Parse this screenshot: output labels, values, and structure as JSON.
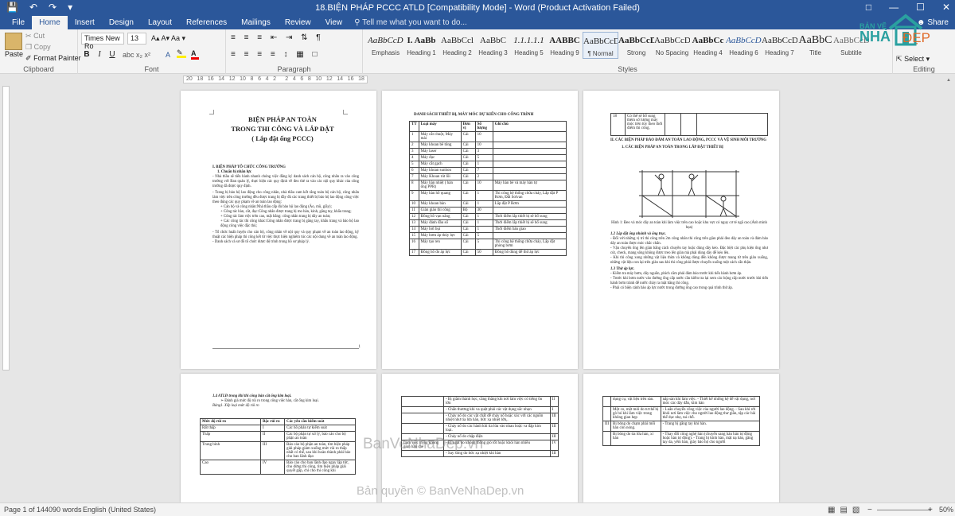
{
  "window": {
    "title": "18.BIỆN PHÁP PCCC  ATLD [Compatibility Mode] - Word (Product Activation Failed)",
    "share": "Share"
  },
  "ribbon": {
    "tabs": [
      "File",
      "Home",
      "Insert",
      "Design",
      "Layout",
      "References",
      "Mailings",
      "Review",
      "View"
    ],
    "active": "Home",
    "tell_me": "Tell me what you want to do...",
    "clipboard": {
      "paste": "Paste",
      "cut": "Cut",
      "copy": "Copy",
      "format_painter": "Format Painter",
      "label": "Clipboard"
    },
    "font": {
      "name": "Times New Ro",
      "size": "13",
      "label": "Font",
      "bold": "B",
      "italic": "I",
      "underline": "U"
    },
    "paragraph": {
      "label": "Paragraph"
    },
    "styles": {
      "label": "Styles",
      "items": [
        {
          "preview": "AaBbCcDc",
          "name": "Emphasis"
        },
        {
          "preview": "I. AaBb",
          "name": "Heading 1"
        },
        {
          "preview": "AaBbCcl",
          "name": "Heading 2"
        },
        {
          "preview": "AaBbC",
          "name": "Heading 3"
        },
        {
          "preview": "1.1.1.1.1",
          "name": "Heading 5"
        },
        {
          "preview": "AABBC",
          "name": "Heading 9"
        },
        {
          "preview": "AaBbCcDc",
          "name": "¶ Normal"
        },
        {
          "preview": "AaBbCcDc",
          "name": "Strong"
        },
        {
          "preview": "AaBbCcDdI",
          "name": "No Spacing"
        },
        {
          "preview": "AaBbCc",
          "name": "Heading 4"
        },
        {
          "preview": "AaBbCcDd",
          "name": "Heading 6"
        },
        {
          "preview": "AaBbCcD",
          "name": "Heading 7"
        },
        {
          "preview": "AaBbC",
          "name": "Title"
        },
        {
          "preview": "AaBbCcDd",
          "name": "Subtitle"
        }
      ],
      "selected": "¶ Normal"
    },
    "editing": {
      "select": "Select",
      "label": "Editing"
    }
  },
  "logo": {
    "line1": "BẢN VẼ",
    "line2": "NHÀ",
    "line3": "ĐẸP"
  },
  "ruler": {
    "ticks": [
      "20",
      "18",
      "16",
      "14",
      "12",
      "10",
      "8",
      "6",
      "4",
      "2",
      "",
      "2",
      "4",
      "6",
      "8",
      "10",
      "12",
      "14",
      "16",
      "18"
    ]
  },
  "page1": {
    "title": [
      "BIỆN PHÁP AN TOÀN",
      "TRONG THI CÔNG VÀ LẮP ĐẶT",
      "( Lắp đặt ống PCCC)"
    ],
    "section": "I. BIỆN PHÁP TỔ CHỨC CÔNG TRƯỜNG",
    "sub": "1.   Chuẩn bị nhân lực",
    "paras": [
      "-  Nhà thầu sẽ tiến hành nhanh chóng việc đăng ký danh sách cán bộ, công nhân ra vào công trường với Ban quản lý, thực hiện các quy định về đeo thẻ ra vào các nội quy khác của công trường đã được quy định.",
      "-  Trang bị bảo hộ lao động cho công nhân, nhà thầu cam kết rằng toàn bộ cán bộ, công nhân làm việc trên công trường đều được trang bị đầy đủ các trang thiết bị bảo hộ lao động công việc theo đúng các quy phạm về an toàn lao động:",
      "+ Cán bộ và công nhân:Nhà thầu cấp đủ bảo hộ lao động (Áo, mũ, giầy);",
      "+ Công tác hàn, cắt, đục:Công nhân được trang bị mo hàn, kính, găng tay, khẩu trang;",
      "+ Công tác làm việc trên cao, mặt bằng: công nhân trang bị dây an toàn;",
      "+ Các công tác thi công khác:Công nhân được trang bị găng tay, khẩu trang và bảo hộ lao động công việc đặc thù;",
      "-  Tổ chức huấn luyện cho cán bộ, công nhân về nội quy và quy phạm về an toàn lao động, kỹ thuật các biện pháp thi công kết từ việc thực hiện nghiêm túc các nội dung về an toàn lao động.",
      "-  Danh sách và sơ đồ tổ chức được đệ trình trong hồ sơ pháp lý."
    ],
    "page_num": "1"
  },
  "page2": {
    "title": "DANH SÁCH THIẾT BỊ, MÁY MÓC DỰ KIẾN CHO CÔNG TRÌNH",
    "headers": [
      "TT",
      "Loại máy",
      "Đơn vị",
      "Số lượng",
      "Ghi chú"
    ],
    "rows": [
      [
        "1",
        "Máy cắt chuột, Máy mài",
        "Cái",
        "10",
        ""
      ],
      [
        "2",
        "Máy khoan bê tông",
        "Cái",
        "10",
        ""
      ],
      [
        "3",
        "Máy laser",
        "Cái",
        "3",
        ""
      ],
      [
        "4",
        "Máy đục",
        "Cái",
        "5",
        ""
      ],
      [
        "5",
        "Máy cắt gạch",
        "Cái",
        "1",
        ""
      ],
      [
        "6",
        "Máy khoan sunhon",
        "Cái",
        "7",
        ""
      ],
      [
        "7",
        "Máy Khoan rút lõi",
        "Cái",
        "2",
        ""
      ],
      [
        "8",
        "Máy hàn nhiệt ( hàn ống PPR)",
        "Cái",
        "10",
        "Máy hàn bè và máy hàn tự"
      ],
      [
        "9",
        "Máy hàn hồ quang",
        "Cái",
        "1",
        "Thi công hệ thống chữa cháy, Lắp đặt P Rơm, Đất Solvan"
      ],
      [
        "10",
        "Máy khoan bàn",
        "Cái",
        "1",
        "Lắp đặt P Rơm"
      ],
      [
        "11",
        "Giàn giáo thi công",
        "Bộ",
        "30",
        ""
      ],
      [
        "12",
        "Đồng hồ vạn năng",
        "Cái",
        "1",
        "Thời điểm lắp thiết bị sẽ bổ sung"
      ],
      [
        "13",
        "Máy đánh đầu số",
        "Cái",
        "1",
        "Thời điểm lắp thiết bị sẽ bổ sung"
      ],
      [
        "14",
        "Máy bơi bụi",
        "Cái",
        "1",
        "Thời điểm bàn giao"
      ],
      [
        "15",
        "Máy bơm áp thủy lực",
        "Cái",
        "5",
        ""
      ],
      [
        "16",
        "Máy tạo ren",
        "Cái",
        "5",
        "Thi công hệ thống chữa cháy, Lắp đặt phòng bơm"
      ],
      [
        "17",
        "Đồng hồ đo áp lực",
        "Cái",
        "50",
        "Đồng hồ dùng để thử áp lực"
      ]
    ]
  },
  "page3": {
    "row18": [
      "18",
      "Có thể sẽ bổ sung thêm số lượng máy móc trên tùy theo thời điểm thi công."
    ],
    "section": "II.  CÁC BIỆN PHÁP BẢO ĐẢM AN TOÀN LAO ĐỘNG, PCCC VÀ VỆ SINH MÔI TRƯỜNG",
    "sub": "1.   CÁC BIỆN PHÁP AN TOÀN TRONG LẮP ĐẶT THIẾT BỊ",
    "caption": "Hình 1: Đeo và móc dây an toàn khi làm việc trên cao hoặc khu vực có nguy cơ té ngã cao (Ảnh minh họa)",
    "h1": "1.2 Lắp đặt ống nhánh và ống trục.",
    "p1": [
      "-  Đối với những vị trí thi công trên 2m công nhân thi công trên giàn phải đeo dây an toàn và đảm bảo dây an toàn được móc chắc chắn.",
      "-  Vận chuyển ống lên giàn bằng cách chuyền tay hoặc dùng dây kéo. Đặc biệt các phụ kiện ống như cút, check, mang sông không được treo lên giàn mà phải dùng dây để kéo lên.",
      "-  Khi thi công xong những vật liệu thừa và không dùng đến không được mang từ trên giàn xuống, những vật liệu con lại trên giàn sau khi thi công phải được chuyển xuống một cách cẩn thận."
    ],
    "h2": "1.3 Thử áp lực.",
    "p2": [
      "-  Kiểm tra máy bơm, dây nguồn, phích cắm phải đảm bảo trước khi tiến hành bơm áp.",
      "-  Trước khi bơm nước vào đường ống cấp nước cần kiểm tra lại xem các hộng cấp nước trước khi tiến hành bơm tránh để nước chảy ra mặt bằng thi công.",
      "-  Phải có biện cảnh báo áp lực nước trong đường ống cao trong quá trình thử áp."
    ]
  },
  "page4": {
    "heading": "1.4 ATLĐ trong khi thi công hàn cắt ống kim loại.",
    "bullet": "Đánh giá mức độ rủi ro trong công việc hàn, cắt ống kim loại.",
    "table_title": "Bảng1. Xếp loại mức độ rủi ro",
    "headers": [
      "Mức độ rủi ro",
      "Bậc rủi ro",
      "Các yêu cầu kiểm soát"
    ],
    "rows": [
      [
        "Rất thấp",
        "I",
        "Các hồ phản tự kiểm soát"
      ],
      [
        "Thấp",
        "II",
        "Các bộ phận tự xử lý, báo cáo cho bộ phận an toàn"
      ],
      [
        "Trung bình",
        "III",
        "Báo cáo bộ phận an toàn, tìm biện pháp giải pháp giảm xuống mức rủi ro thấp nhất có thể, sau khi hoàn thành phải báo cho ban lãnh đạo"
      ],
      [
        "Cao",
        "IV",
        "Báo cáo cho ban lãnh đạo ngay lập tức, cho dừng thi công, tìm biện pháp giải quyết gấp, chỉ cho thi công khi"
      ]
    ]
  },
  "page5": {
    "rows": [
      [
        "",
        "- Bị giằm thành học, căng thẳng khi nơi làm việc có tiếng ồn lớn",
        "II"
      ],
      [
        "",
        "- Chấn thương khi va quệt phải các vật dụng sắc nhọn",
        "I"
      ],
      [
        "",
        "- Cháy nổ do các vật chất dễ cháy nổ hoặc xúc với các nguồn nhiệt như tia lửa hàn, bức xạ nhiệt lớn,.",
        "III"
      ],
      [
        "",
        "- Cháy nổ do các hành khi tia lửa vào nhau hoặc va đập kim loại.",
        "III"
      ],
      [
        "",
        "- Cháy nổ do chập điện",
        "III"
      ],
      [
        "Làm việc trong không gian hạn chế",
        "- Bị ngạt do không thông gió tốt hoặc khói hàn nhiều",
        "IV"
      ],
      [
        "",
        "- Say sóng do bức xạ nhiệt khi hàn",
        "III"
      ]
    ]
  },
  "page6": {
    "rows": [
      [
        "",
        "dụng cụ, vật liệu trên sàn.",
        "nắp sàn khi làm việc. - Thiết kế những kệ để vật dụng, nơi móc các dây dẫn, kìm hàn"
      ],
      [
        "",
        "Một co, mệt mỏi do tư thế bị gò bó khi làm việc trong không gian hẹp",
        "- Luân chuyển công việc của người lao động. - Sau khi rời khỏi nơi làm việc cho người lao động thư giãn, tập các bài thể dục nhẹ, tai chỗ."
      ],
      [
        "III",
        "Bị bỏng do chạm phải mối hàn còn nóng.",
        "- Trang bị găng tay khi hàn."
      ],
      [
        "",
        "Bị bỏng do tia lửa hàn, xỉ hàn",
        "- Thay đổi công nghệ hàn (chuyển sang hàn bán tự động hoặc hàn tự động). - Trang bị kính hàn, mặt nạ hàn, găng tay da, yếm hàn, giày bảo hộ cho người"
      ]
    ]
  },
  "watermarks": {
    "center": "BanVeNhaDep.vn",
    "footer": "Bản quyền © BanVeNhaDep.vn"
  },
  "status": {
    "page": "Page 1 of 14",
    "words": "4090 words",
    "language": "English (United States)",
    "zoom": "50%"
  }
}
